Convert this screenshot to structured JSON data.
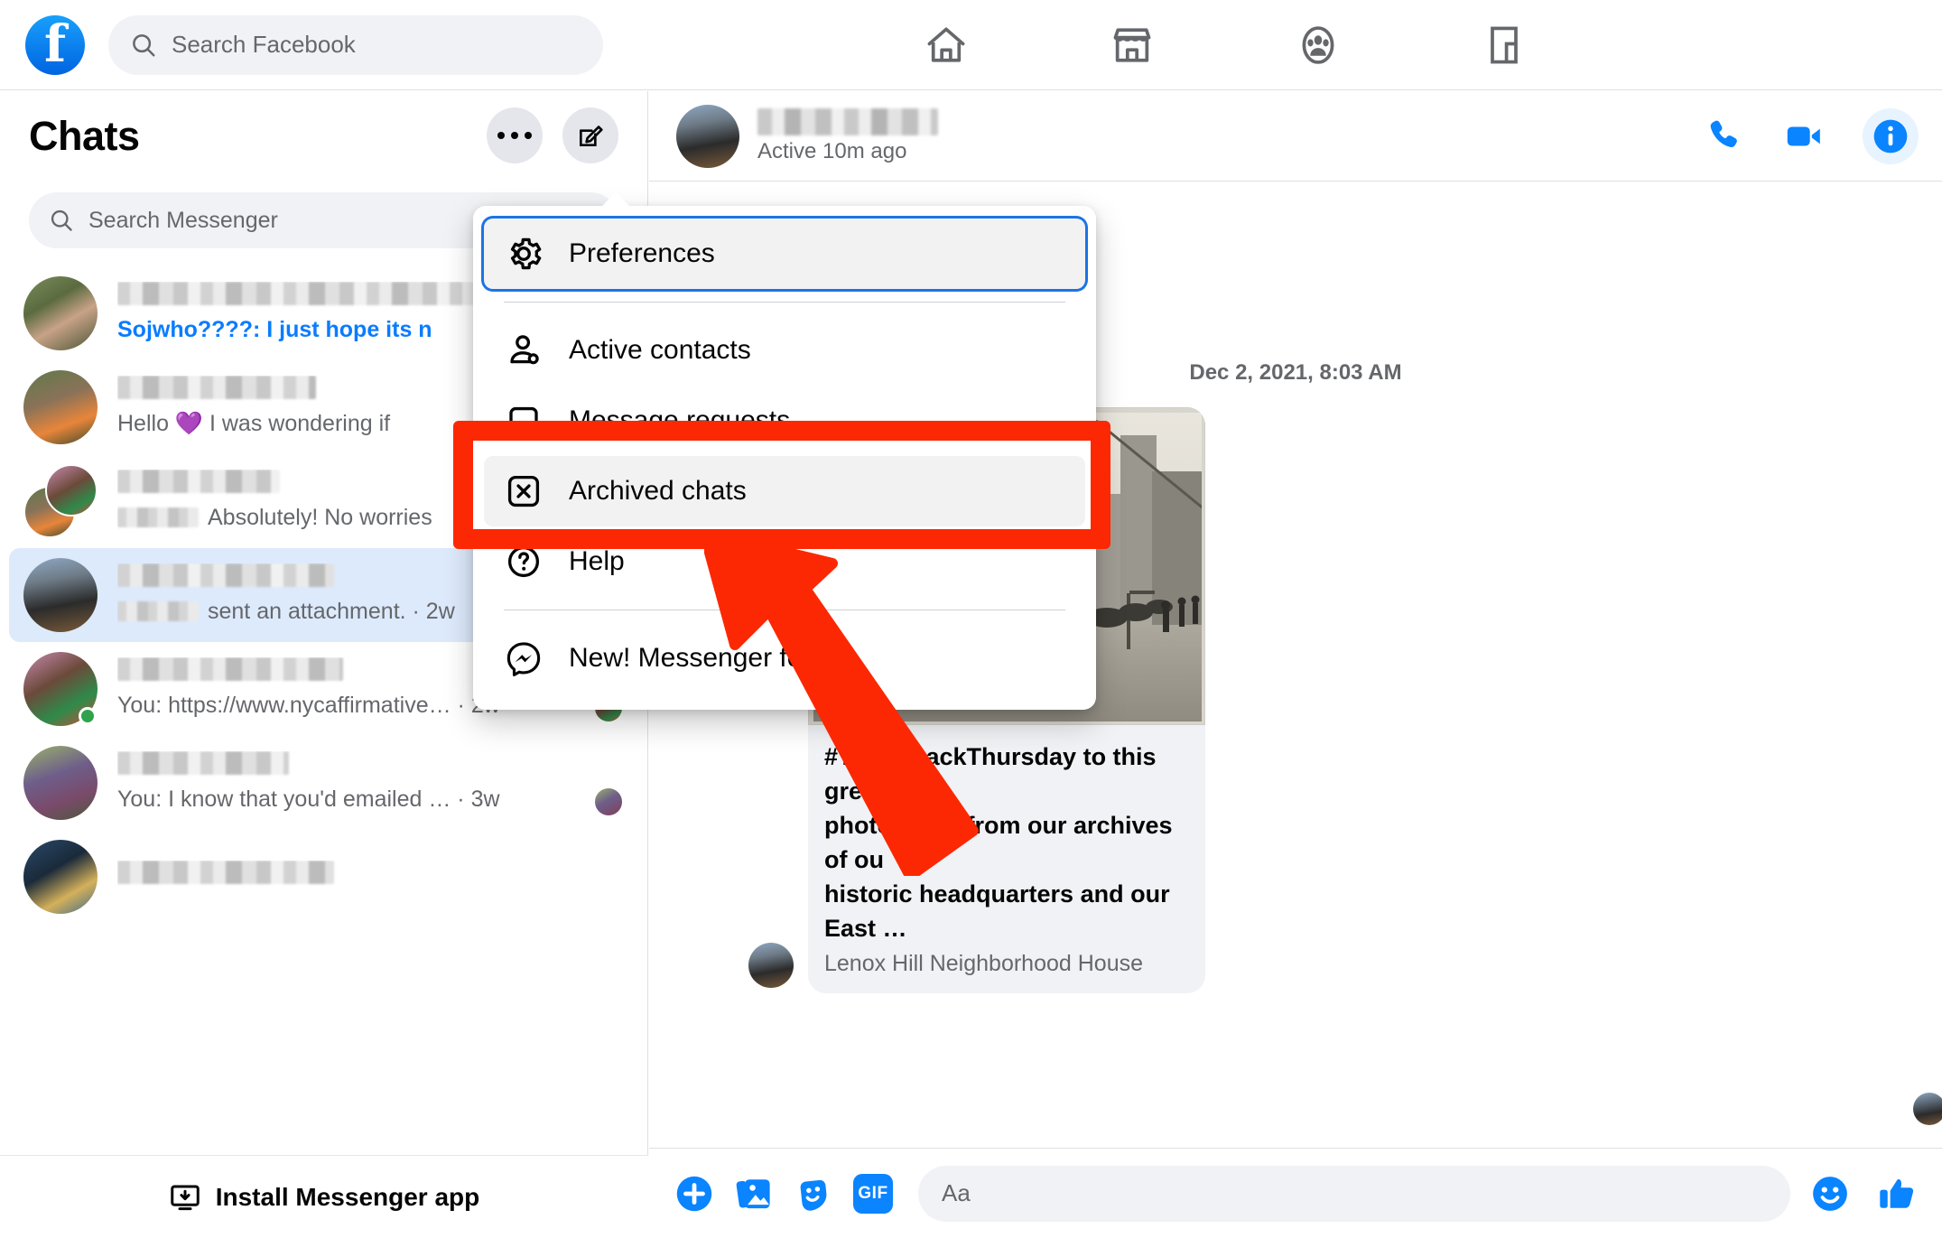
{
  "topbar": {
    "logo_letter": "f",
    "search": {
      "placeholder": "Search Facebook",
      "icon": "search-icon"
    },
    "nav": [
      {
        "name": "home-icon",
        "label": "Home"
      },
      {
        "name": "marketplace-icon",
        "label": "Marketplace"
      },
      {
        "name": "groups-icon",
        "label": "Groups"
      },
      {
        "name": "gaming-icon",
        "label": "Gaming"
      }
    ]
  },
  "sidebar": {
    "title": "Chats",
    "options_button": "options-button",
    "compose_button": "new-message-button",
    "search": {
      "placeholder": "Search Messenger",
      "icon": "search-icon"
    },
    "rows": [
      {
        "name_redacted": true,
        "snippet": "Sojwho????: I just hope its n",
        "unread": true,
        "time": "",
        "sender_redacted": false,
        "online": false,
        "receipt": false,
        "selected": false,
        "stacked": false
      },
      {
        "name_redacted": true,
        "snippet": "Hello 💜 I was wondering if",
        "unread": false,
        "time": "",
        "sender_redacted": false,
        "online": false,
        "receipt": false,
        "selected": false,
        "stacked": false
      },
      {
        "name_redacted": true,
        "snippet": "Absolutely! No worries",
        "unread": false,
        "time": "",
        "sender_redacted": true,
        "online": false,
        "receipt": false,
        "selected": false,
        "stacked": true
      },
      {
        "name_redacted": true,
        "snippet": "sent an attachment. · 2w",
        "unread": false,
        "time": "2w",
        "sender_redacted": true,
        "online": false,
        "receipt": false,
        "selected": true,
        "stacked": false
      },
      {
        "name_redacted": true,
        "snippet": "You: https://www.nycaffirmative…  · 2w",
        "unread": false,
        "time": "2w",
        "sender_redacted": false,
        "online": true,
        "receipt": true,
        "selected": false,
        "stacked": false
      },
      {
        "name_redacted": true,
        "snippet": "You: I know that you'd emailed …  · 3w",
        "unread": false,
        "time": "3w",
        "sender_redacted": false,
        "online": false,
        "receipt": true,
        "selected": false,
        "stacked": false
      },
      {
        "name_redacted": true,
        "snippet": "",
        "unread": false,
        "time": "",
        "sender_redacted": false,
        "online": false,
        "receipt": false,
        "selected": false,
        "stacked": false
      }
    ],
    "install": {
      "label": "Install Messenger app",
      "icon": "install-monitor-icon"
    }
  },
  "menu": {
    "items": [
      {
        "label": "Preferences",
        "icon": "gear-icon",
        "state": "focused"
      },
      {
        "label": "Active contacts",
        "icon": "person-icon",
        "state": "normal"
      },
      {
        "label": "Message requests",
        "icon": "message-bubble-icon",
        "state": "occluded"
      },
      {
        "label": "Archived chats",
        "icon": "archive-x-icon",
        "state": "hovered"
      },
      {
        "label": "Help",
        "icon": "question-circle-icon",
        "state": "normal"
      },
      {
        "label": "New! Messenger for",
        "icon": "messenger-icon",
        "state": "normal"
      }
    ]
  },
  "thread": {
    "name_redacted": true,
    "status": "Active 10m ago",
    "actions": [
      {
        "name": "audio-call-icon",
        "label": "Call"
      },
      {
        "name": "video-call-icon",
        "label": "Video call"
      },
      {
        "name": "conversation-info-icon",
        "label": "Conversation information"
      }
    ],
    "datestamp": "Dec 2, 2021, 8:03 AM",
    "attachment": {
      "caption_title": "#ThrowbackThursday to this gre\nphotograph from our archives of ou\nhistoric headquarters and our East …",
      "caption_source": "Lenox Hill Neighborhood House"
    }
  },
  "composer": {
    "buttons": [
      {
        "name": "add-attachment-icon",
        "label": "Add"
      },
      {
        "name": "photo-icon",
        "label": "Photos"
      },
      {
        "name": "sticker-icon",
        "label": "Stickers"
      },
      {
        "name": "gif-icon",
        "label": "GIF"
      }
    ],
    "input_placeholder": "Aa",
    "emoji_icon": "emoji-icon",
    "like_icon": "thumbs-up-icon"
  },
  "annotation": {
    "highlight_target": "Archived chats",
    "box_color": "#fc2803",
    "arrow_color": "#fc2803"
  },
  "colors": {
    "fb_blue": "#1877f2",
    "accent_blue": "#0a7cff",
    "focus_blue": "#1b74e4",
    "selected_row": "#ddeafc",
    "grey_bg": "#f0f2f5",
    "text_primary": "#050505",
    "text_secondary": "#65676b",
    "online_green": "#31a24c"
  }
}
